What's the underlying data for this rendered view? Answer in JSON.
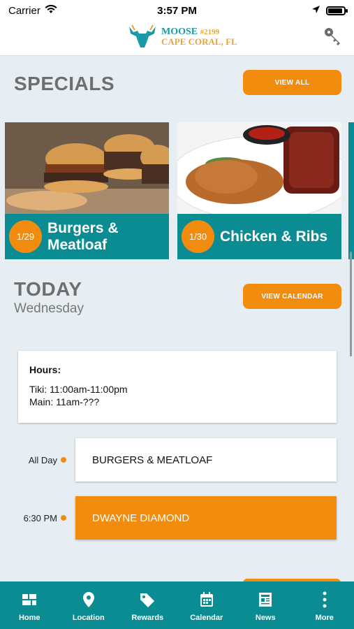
{
  "status": {
    "carrier": "Carrier",
    "time": "3:57 PM"
  },
  "header": {
    "logo_line1": "MOOSE",
    "logo_number": "#2199",
    "logo_line2": "CAPE CORAL, FL"
  },
  "specials": {
    "title": "SPECIALS",
    "view_all": "VIEW ALL",
    "cards": [
      {
        "date": "1/29",
        "title": "Burgers & Meatloaf"
      },
      {
        "date": "1/30",
        "title": "Chicken & Ribs"
      }
    ]
  },
  "today": {
    "title": "TODAY",
    "day": "Wednesday",
    "view_calendar": "VIEW CALENDAR",
    "hours_label": "Hours:",
    "hours_line1": "Tiki: 11:00am-11:00pm",
    "hours_line2": "Main: 11am-???",
    "events": [
      {
        "time": "All Day",
        "title": "BURGERS & MEATLOAF"
      },
      {
        "time": "6:30 PM",
        "title": "DWAYNE DIAMOND"
      }
    ]
  },
  "tabs": [
    "Home",
    "Location",
    "Rewards",
    "Calendar",
    "News",
    "More"
  ],
  "colors": {
    "accent": "#f28c0f",
    "brand": "#0a8c92",
    "background": "#e6eef3"
  }
}
